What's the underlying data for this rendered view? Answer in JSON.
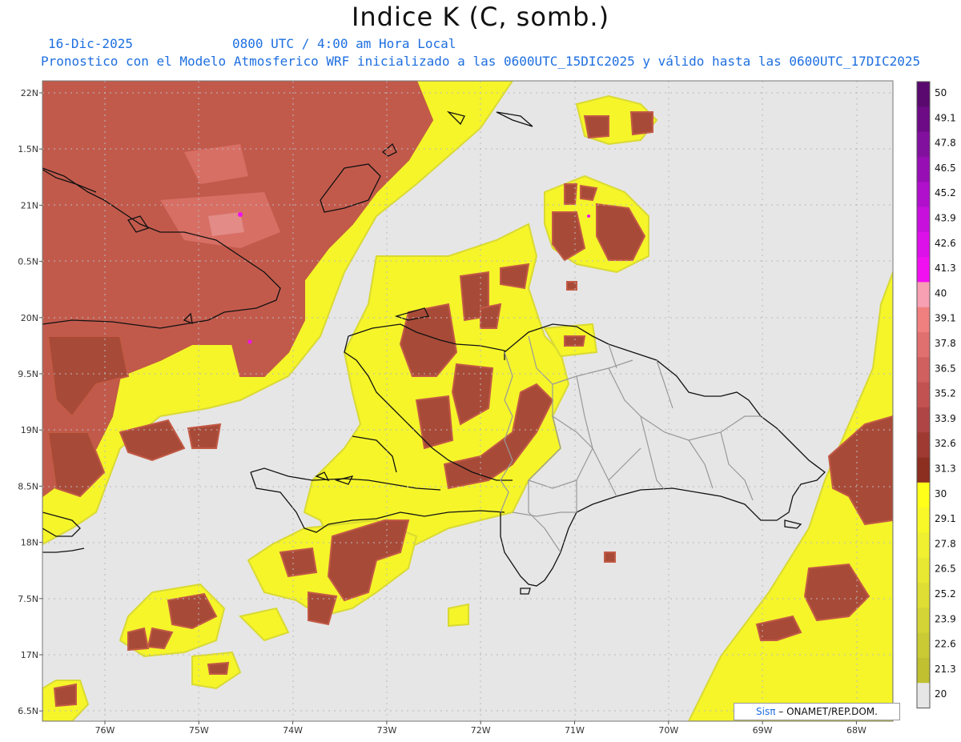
{
  "header": {
    "title": "Indice K (C, somb.)",
    "date": "16-Dic-2025",
    "time": "0800 UTC / 4:00 am Hora Local",
    "description": "Pronostico con el Modelo Atmosferico WRF inicializado a las 0600UTC_15DIC2025 y válido hasta las  0600UTC_17DIC2025"
  },
  "map": {
    "lat_labels": [
      "22N",
      "1.5N",
      "21N",
      "0.5N",
      "20N",
      "9.5N",
      "19N",
      "8.5N",
      "18N",
      "7.5N",
      "17N",
      "6.5N"
    ],
    "lon_labels": [
      "76W",
      "75W",
      "74W",
      "73W",
      "72W",
      "71W",
      "70W",
      "69W",
      "68W"
    ]
  },
  "colorbar": {
    "labels": [
      "50",
      "49.1",
      "47.8",
      "46.5",
      "45.2",
      "43.9",
      "42.6",
      "41.3",
      "40",
      "39.1",
      "37.8",
      "36.5",
      "35.2",
      "33.9",
      "32.6",
      "31.3",
      "30",
      "29.1",
      "27.8",
      "26.5",
      "25.2",
      "23.9",
      "22.6",
      "21.3",
      "20"
    ],
    "colors": [
      "#5a0a6e",
      "#6d0a86",
      "#82109e",
      "#980eb5",
      "#b00fcc",
      "#c810dd",
      "#dc10e8",
      "#f010f0",
      "#f7a0b4",
      "#f08080",
      "#e07070",
      "#d06060",
      "#c25252",
      "#b04545",
      "#9e3a32",
      "#8c2e20",
      "#ffff1a",
      "#f8f828",
      "#f0f030",
      "#e8e832",
      "#dede34",
      "#d4d436",
      "#caca34",
      "#c0c030",
      "#e6e6e6"
    ]
  },
  "credit": {
    "brand": "Sisπ",
    "text": " – ONAMET/REP.DOM."
  }
}
